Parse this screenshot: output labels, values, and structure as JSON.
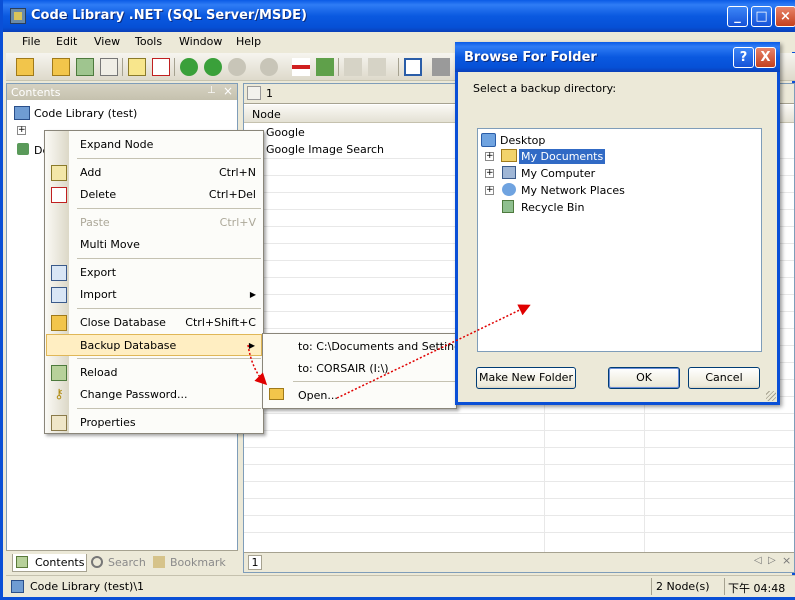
{
  "window": {
    "title": "Code Library .NET (SQL Server/MSDE)"
  },
  "menubar": [
    "File",
    "Edit",
    "View",
    "Tools",
    "Window",
    "Help"
  ],
  "contents": {
    "title": "Contents",
    "root": "Code Library (test)",
    "child_deleted": "De"
  },
  "bottom_tabs": [
    "Contents",
    "Search",
    "Bookmark"
  ],
  "list": {
    "nav_value": "1",
    "column_header": "Node",
    "rows": [
      "Google",
      "Google Image Search"
    ],
    "footer_page": "1"
  },
  "context_menu": {
    "items": [
      {
        "label": "Expand Node",
        "shortcut": ""
      },
      {
        "label": "Add",
        "shortcut": "Ctrl+N"
      },
      {
        "label": "Delete",
        "shortcut": "Ctrl+Del"
      },
      {
        "label": "Paste",
        "shortcut": "Ctrl+V"
      },
      {
        "label": "Multi Move",
        "shortcut": ""
      },
      {
        "label": "Export",
        "shortcut": ""
      },
      {
        "label": "Import",
        "shortcut": ""
      },
      {
        "label": "Close Database",
        "shortcut": "Ctrl+Shift+C"
      },
      {
        "label": "Backup Database",
        "shortcut": ""
      },
      {
        "label": "Reload",
        "shortcut": ""
      },
      {
        "label": "Change Password...",
        "shortcut": ""
      },
      {
        "label": "Properties",
        "shortcut": ""
      }
    ]
  },
  "submenu": {
    "items": [
      "to: C:\\Documents and Settings\\",
      "to: CORSAIR (I:\\)",
      "Open..."
    ]
  },
  "browse_dialog": {
    "title": "Browse For Folder",
    "instruction": "Select a backup directory:",
    "tree": [
      "Desktop",
      "My Documents",
      "My Computer",
      "My Network Places",
      "Recycle Bin"
    ],
    "make_folder": "Make New Folder",
    "ok": "OK",
    "cancel": "Cancel",
    "help_glyph": "?",
    "close_glyph": "X"
  },
  "statusbar": {
    "left": "Code Library (test)\\1",
    "count": "2 Node(s)",
    "time": "下午 04:48"
  },
  "colors": {
    "accent": "#0a4fd6",
    "highlight": "#ffeec2",
    "arrow": "#e00000"
  }
}
